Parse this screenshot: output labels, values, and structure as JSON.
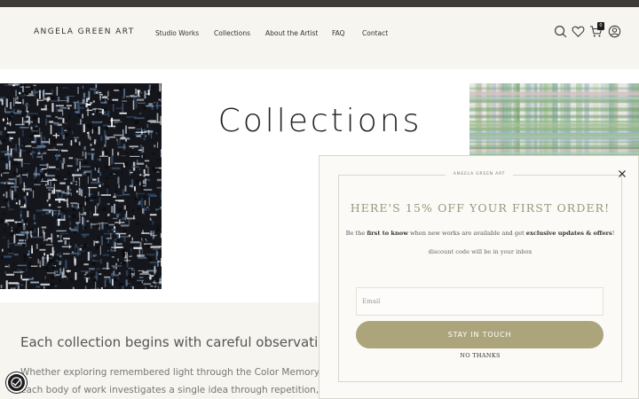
{
  "header": {
    "logo": "ANGELA GREEN ART",
    "nav": [
      "Studio Works",
      "Collections",
      "About the Artist",
      "FAQ",
      "Contact"
    ],
    "cart_count": "0",
    "icons": [
      "search-icon",
      "heart-icon",
      "cart-icon",
      "account-icon"
    ]
  },
  "hero": {
    "title": "Collections"
  },
  "intro": {
    "heading": "Each collection begins with careful observatio",
    "p1": "Whether exploring remembered light through the Color Memory Seri",
    "p2": "each body of work investigates a single idea through repetition, lay"
  },
  "popup": {
    "brand": "ANGELA GREEN ART",
    "headline": "HERE'S 15% OFF YOUR FIRST ORDER!",
    "body_pre": "Be the ",
    "body_b1": "first to know",
    "body_mid": " when new works are available and get ",
    "body_b2": "exclusive updates & offers",
    "body_post": "!",
    "sub": "discount code will be in your inbox",
    "email_placeholder": "Email",
    "cta": "STAY IN TOUCH",
    "no_thanks": "NO THANKS"
  },
  "colors": {
    "topbar": "#3e3a37",
    "header_bg": "#f6f5f0",
    "accent": "#aca57c",
    "headline": "#9a9679"
  }
}
